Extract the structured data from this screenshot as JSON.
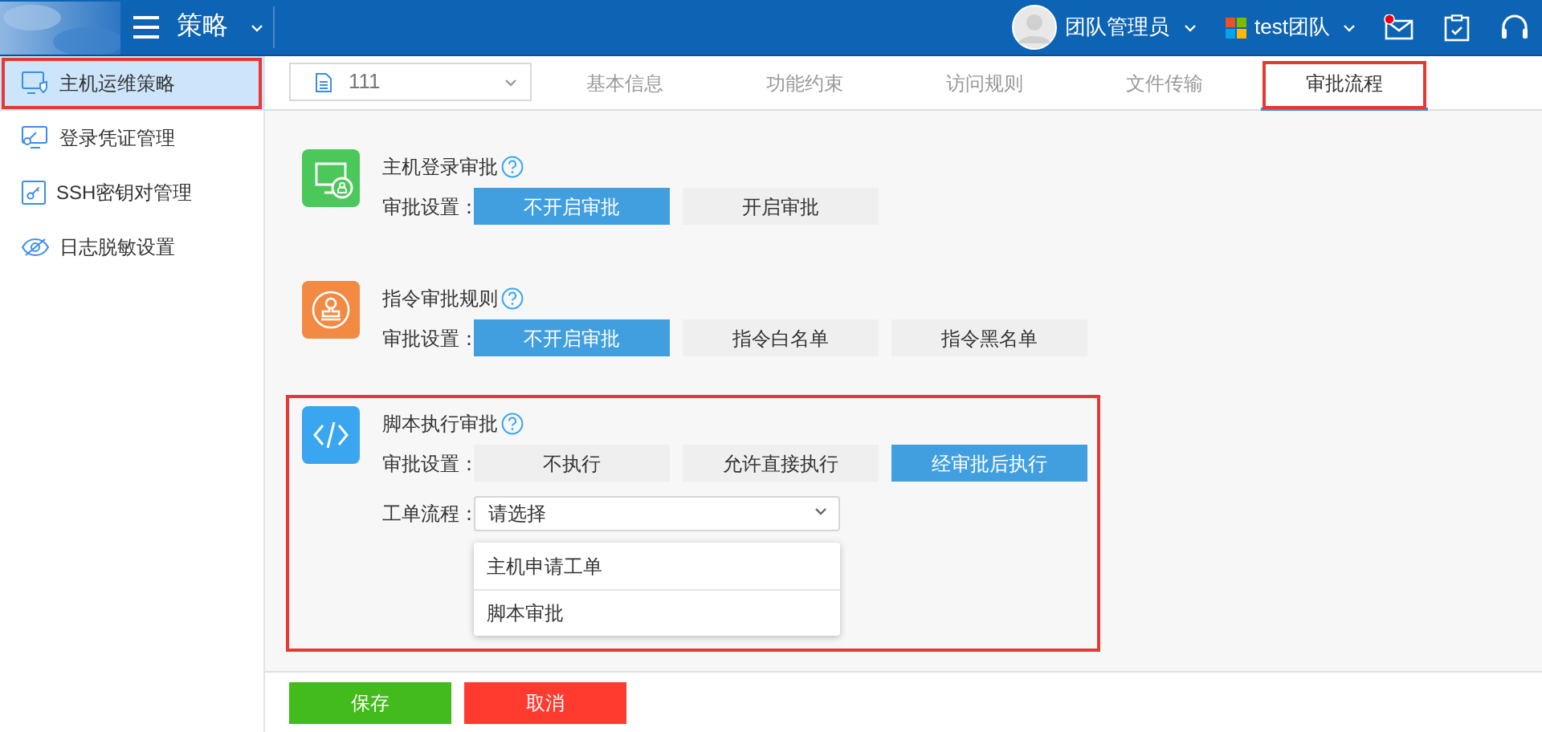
{
  "header": {
    "title": "策略",
    "user": "团队管理员",
    "team": "test团队",
    "mail_unread": true
  },
  "sidebar": {
    "items": [
      {
        "label": "主机运维策略",
        "selected": true,
        "annotated": true
      },
      {
        "label": "登录凭证管理",
        "selected": false,
        "annotated": false
      },
      {
        "label": "SSH密钥对管理",
        "selected": false,
        "annotated": false
      },
      {
        "label": "日志脱敏设置",
        "selected": false,
        "annotated": false
      }
    ]
  },
  "policy_select": {
    "value": "111"
  },
  "tabs": [
    {
      "label": "基本信息",
      "selected": false,
      "annotated": false
    },
    {
      "label": "功能约束",
      "selected": false,
      "annotated": false
    },
    {
      "label": "访问规则",
      "selected": false,
      "annotated": false
    },
    {
      "label": "文件传输",
      "selected": false,
      "annotated": false
    },
    {
      "label": "审批流程",
      "selected": true,
      "annotated": true
    }
  ],
  "sections": [
    {
      "title": "主机登录审批",
      "color": "#4cc85a",
      "annotated": false,
      "setting_label": "审批设置：",
      "options": [
        {
          "label": "不开启审批",
          "selected": true
        },
        {
          "label": "开启审批",
          "selected": false
        }
      ]
    },
    {
      "title": "指令审批规则",
      "color": "#f28a44",
      "annotated": false,
      "setting_label": "审批设置：",
      "options": [
        {
          "label": "不开启审批",
          "selected": true
        },
        {
          "label": "指令白名单",
          "selected": false
        },
        {
          "label": "指令黑名单",
          "selected": false
        }
      ]
    },
    {
      "title": "脚本执行审批",
      "color": "#3aa6ef",
      "annotated": true,
      "setting_label": "审批设置：",
      "options": [
        {
          "label": "不执行",
          "selected": false
        },
        {
          "label": "允许直接执行",
          "selected": false
        },
        {
          "label": "经审批后执行",
          "selected": true
        }
      ],
      "workflow": {
        "label": "工单流程：",
        "placeholder": "请选择",
        "expanded": true,
        "options": [
          "主机申请工单",
          "脚本审批"
        ]
      }
    }
  ],
  "footer": {
    "buttons": [
      {
        "label": "保存"
      },
      {
        "label": "取消"
      }
    ]
  }
}
